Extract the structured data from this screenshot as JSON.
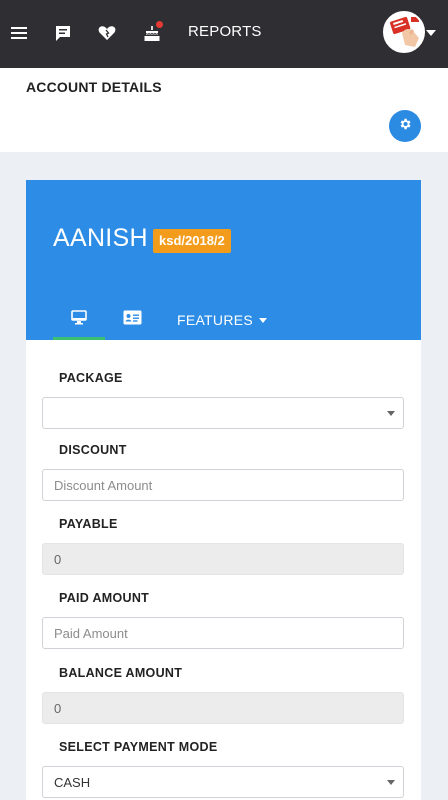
{
  "topbar": {
    "reports_label": "REPORTS",
    "icons": [
      "menu-icon",
      "chat-icon",
      "heart-icon",
      "cake-icon"
    ]
  },
  "header": {
    "title": "ACCOUNT DETAILS"
  },
  "account": {
    "name": "AANISH",
    "id_badge": "ksd/2018/2",
    "features_label": "FEATURES"
  },
  "form": {
    "package": {
      "label": "PACKAGE",
      "value": ""
    },
    "discount": {
      "label": "DISCOUNT",
      "placeholder": "Discount Amount"
    },
    "payable": {
      "label": "PAYABLE",
      "value": "0"
    },
    "paid_amount": {
      "label": "PAID AMOUNT",
      "placeholder": "Paid Amount"
    },
    "balance_amount": {
      "label": "BALANCE AMOUNT",
      "value": "0"
    },
    "payment_mode": {
      "label": "SELECT PAYMENT MODE",
      "value": "CASH"
    }
  },
  "colors": {
    "topbar": "#2f2f33",
    "card_header": "#2d8de6",
    "badge": "#f39c1c",
    "tab_active": "#3bbf73",
    "gear_button": "#2b8ae2"
  }
}
